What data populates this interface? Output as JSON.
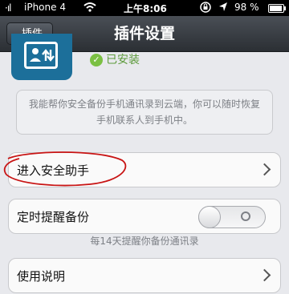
{
  "status_bar": {
    "signal": "·ıl",
    "carrier": "iPhone 4",
    "time": "上午8:06",
    "battery": "98 %"
  },
  "nav": {
    "back_label": "插件",
    "title": "插件设置"
  },
  "plugin": {
    "icon_name": "contacts-backup-icon",
    "status_label": "已安装"
  },
  "description": "我能帮你安全备份手机通讯录到云端，你可以随时恢复手机联系人到手机中。",
  "menu": {
    "enter_assistant": "进入安全助手",
    "scheduled_backup": "定时提醒备份",
    "scheduled_backup_on": false,
    "backup_hint": "每14天提醒你备份通讯录",
    "usage_guide": "使用说明"
  },
  "colors": {
    "nav_bg": "#2b2f34",
    "icon_bg": "#1c6f9a",
    "installed_green": "#7bc043",
    "annotation_red": "#c81414"
  }
}
